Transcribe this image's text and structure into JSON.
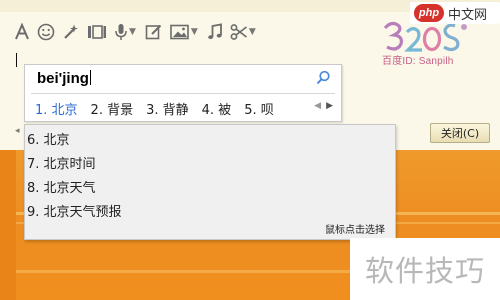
{
  "watermark": {
    "badge": "php",
    "site": "中文网"
  },
  "logo": {
    "caption": "百度ID: Sanpilh"
  },
  "toolbar": {
    "icons": [
      "font-icon",
      "emoji-icon",
      "magic-icon",
      "screenshot-icon",
      "microphone-icon",
      "edit-icon",
      "image-icon",
      "music-icon",
      "scissors-icon"
    ]
  },
  "chat": {
    "close_button": "关闭(C)"
  },
  "ime": {
    "pinyin": "bei'jing",
    "candidates": [
      {
        "label": "1. 北京",
        "selected": true
      },
      {
        "label": "2. 背景",
        "selected": false
      },
      {
        "label": "3. 背静",
        "selected": false
      },
      {
        "label": "4. 被",
        "selected": false
      },
      {
        "label": "5. 呗",
        "selected": false
      }
    ]
  },
  "suggestions": {
    "items": [
      "6. 北京",
      "7. 北京时间",
      "8. 北京天气",
      "9. 北京天气预报"
    ],
    "hint": "鼠标点击选择"
  },
  "overlay_text": "软件技巧",
  "colors": {
    "chat_background": "#fbf8e9",
    "desktop_orange": "#ef9a2c",
    "selected_candidate": "#2b6cd4",
    "watermark_red": "#d4322a"
  }
}
